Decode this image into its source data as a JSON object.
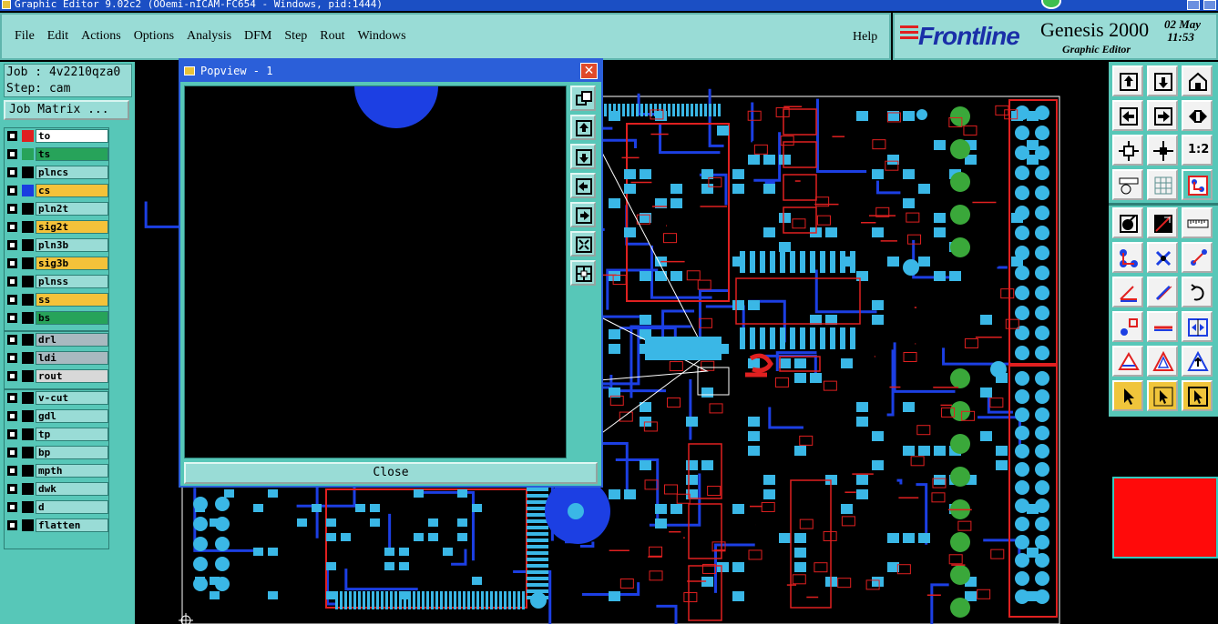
{
  "window": {
    "title": "Graphic Editor 9.02c2 (OOemi-nICAM-FC654 - Windows, pid:1444)"
  },
  "menu": {
    "items": [
      "File",
      "Edit",
      "Actions",
      "Options",
      "Analysis",
      "DFM",
      "Step",
      "Rout",
      "Windows"
    ],
    "help": "Help"
  },
  "brand": {
    "logo": "Frontline",
    "product": "Genesis 2000",
    "subtitle": "Graphic Editor",
    "date_day": "02",
    "date_month": "May",
    "time": "11:53"
  },
  "job": {
    "job_line": "Job : 4v2210qza0",
    "step_line": "Step: cam",
    "matrix_button": "Job Matrix ..."
  },
  "layers": [
    {
      "name": "to",
      "color": "#ffffff",
      "swatch": "#e02020",
      "group": 1
    },
    {
      "name": "ts",
      "color": "#27a35a",
      "swatch": "#27a35a",
      "group": 1
    },
    {
      "name": "plncs",
      "color": "#99dcd6",
      "swatch": "#000000",
      "group": 1
    },
    {
      "name": "cs",
      "color": "#f4c23a",
      "swatch": "#1a3ce0",
      "group": 1
    },
    {
      "name": "pln2t",
      "color": "#99dcd6",
      "swatch": "#000000",
      "group": 1
    },
    {
      "name": "sig2t",
      "color": "#f4c23a",
      "swatch": "#000000",
      "group": 1
    },
    {
      "name": "pln3b",
      "color": "#99dcd6",
      "swatch": "#000000",
      "group": 1
    },
    {
      "name": "sig3b",
      "color": "#f4c23a",
      "swatch": "#000000",
      "group": 1
    },
    {
      "name": "plnss",
      "color": "#99dcd6",
      "swatch": "#000000",
      "group": 1
    },
    {
      "name": "ss",
      "color": "#f4c23a",
      "swatch": "#000000",
      "group": 1
    },
    {
      "name": "bs",
      "color": "#27a35a",
      "swatch": "#000000",
      "group": 1
    },
    {
      "name": "drl",
      "color": "#a8b9c0",
      "swatch": "#000000",
      "group": 2
    },
    {
      "name": "ldi",
      "color": "#a8b9c0",
      "swatch": "#000000",
      "group": 2
    },
    {
      "name": "rout",
      "color": "#d8d8d8",
      "swatch": "#000000",
      "group": 2
    },
    {
      "name": "v-cut",
      "color": "#99dcd6",
      "swatch": "#000000",
      "group": 3
    },
    {
      "name": "gdl",
      "color": "#99dcd6",
      "swatch": "#000000",
      "group": 3
    },
    {
      "name": "tp",
      "color": "#99dcd6",
      "swatch": "#000000",
      "group": 3
    },
    {
      "name": "bp",
      "color": "#99dcd6",
      "swatch": "#000000",
      "group": 3
    },
    {
      "name": "mpth",
      "color": "#99dcd6",
      "swatch": "#000000",
      "group": 3
    },
    {
      "name": "dwk",
      "color": "#99dcd6",
      "swatch": "#000000",
      "group": 3
    },
    {
      "name": "d",
      "color": "#99dcd6",
      "swatch": "#000000",
      "group": 3
    },
    {
      "name": "flatten",
      "color": "#99dcd6",
      "swatch": "#000000",
      "group": 3
    }
  ],
  "popview": {
    "title": "Popview - 1",
    "close_label": "Close"
  },
  "right_tools": {
    "zoom_label": "1:2"
  },
  "colors": {
    "panel": "#57c7b8",
    "panel_light": "#99dcd6",
    "pcb_copper": "#3ab7e6",
    "pcb_trace": "#1c3fe3",
    "pcb_silk": "#e02020",
    "pad_green": "#3aa83a"
  }
}
